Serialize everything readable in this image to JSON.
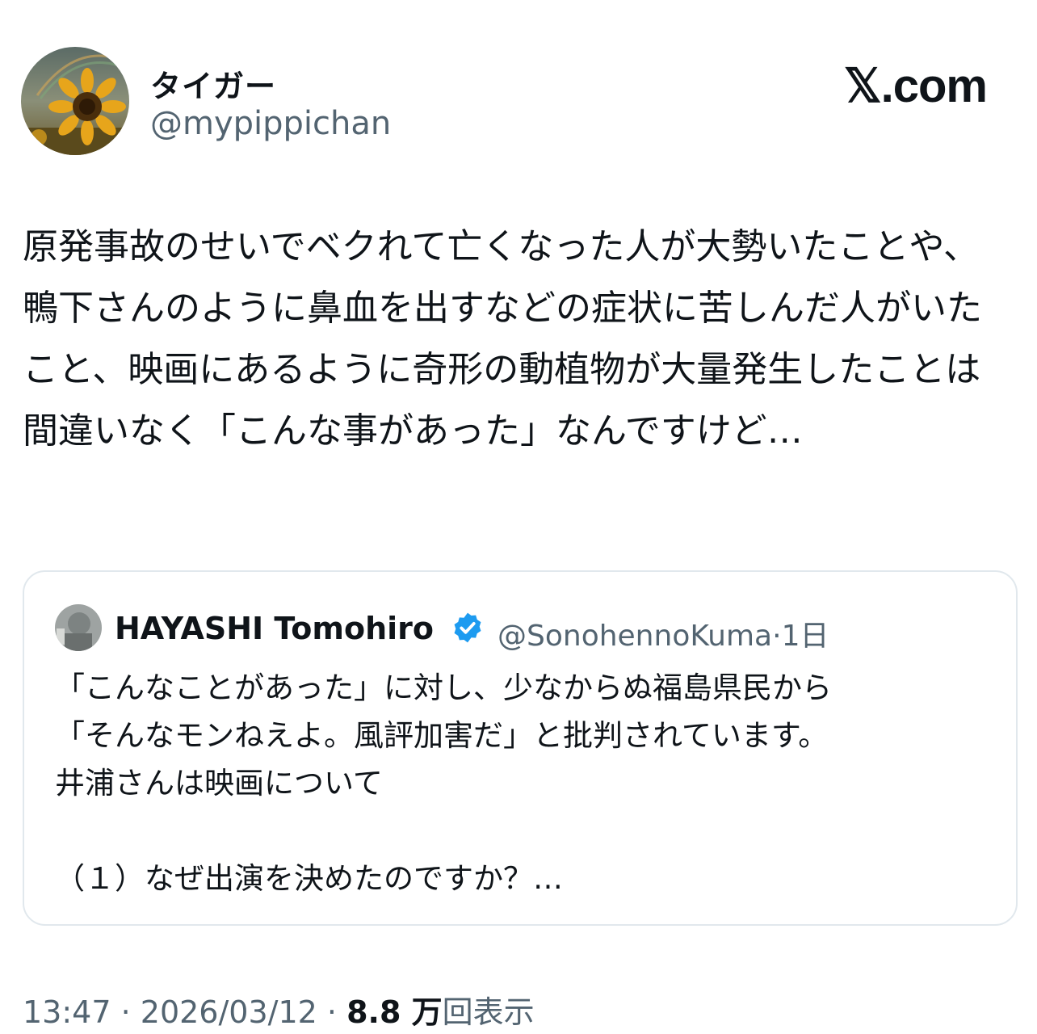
{
  "author": {
    "name": "タイガー",
    "handle": "@mypippichan",
    "avatar_icon": "sunflower-avatar-icon"
  },
  "brand": "𝕏.com",
  "post": {
    "text": "原発事故のせいでベクれて亡くなった人が大勢いたことや、鴨下さんのように鼻血を出すなどの症状に苦しんだ人がいたこと、映画にあるように奇形の動植物が大量発生したことは間違いなく「こんな事があった」なんですけど…"
  },
  "quote": {
    "name": "HAYASHI Tomohiro",
    "handle": "@SonohennoKuma",
    "time": "1日",
    "verified_color": "#1d9bf0",
    "text": "「こんなことがあった」に対し、少なからぬ福島県民から\n「そんなモンねえよ。風評加害だ」と批判されています。\n井浦さんは映画について\n\n（１）なぜ出演を決めたのですか？…"
  },
  "meta": {
    "time": "13:47",
    "date": "2026/03/12",
    "views_count": "8.8 万",
    "views_label": "回表示"
  }
}
